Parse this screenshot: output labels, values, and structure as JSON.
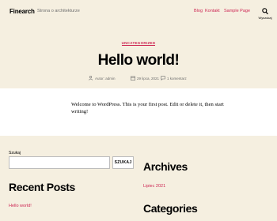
{
  "header": {
    "site_title": "Finearch",
    "site_description": "Strona o architekturze",
    "menu": [
      "Blog",
      "Kontakt",
      "Sample Page"
    ],
    "search_label": "Wyszukaj",
    "search_icon": "search-icon"
  },
  "post": {
    "category": "UNCATEGORIZED",
    "title": "Hello world!",
    "author": "Autor: admin",
    "date": "29 lipca, 2021",
    "comments": "1 komentarz",
    "content": "Welcome to WordPress. This is your first post. Edit or delete it, then start writing!"
  },
  "widgets": {
    "search": {
      "label": "Szukaj",
      "value": "",
      "button": "SZUKAJ"
    },
    "recent_posts": {
      "title": "Recent Posts",
      "items": [
        "Hello world!"
      ]
    },
    "archives": {
      "title": "Archives",
      "items": [
        "Lipiec 2021"
      ]
    },
    "categories": {
      "title": "Categories"
    }
  },
  "colors": {
    "accent": "#cd2653",
    "background": "#f5efe0",
    "content_background": "#ffffff",
    "muted_text": "#6d6d6d"
  }
}
